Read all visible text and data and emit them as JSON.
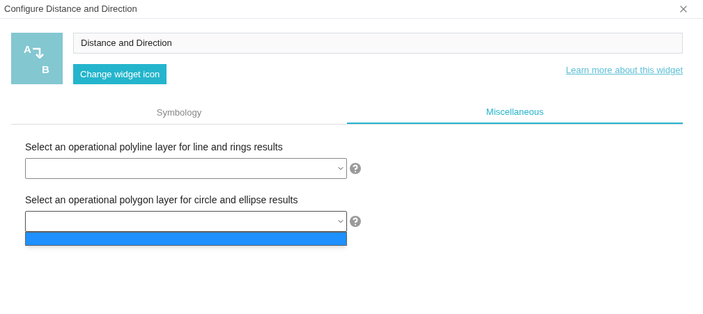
{
  "dialog": {
    "title": "Configure Distance and Direction"
  },
  "widget": {
    "icon_letters": [
      "A",
      "B"
    ],
    "name": "Distance and Direction",
    "change_icon_button": "Change widget icon",
    "learn_more_link": "Learn more about this widget"
  },
  "tabs": [
    {
      "label": "Symbology",
      "selected": false
    },
    {
      "label": "Miscellaneous",
      "selected": true
    }
  ],
  "settings": [
    {
      "label": "Select an operational polyline layer for line and rings results",
      "open": false
    },
    {
      "label": "Select an operational polygon layer for circle and ellipse results",
      "open": true
    }
  ]
}
